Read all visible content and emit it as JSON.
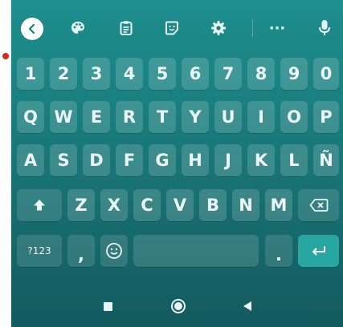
{
  "toolbar": {
    "icons": [
      "back-icon",
      "palette-icon",
      "clipboard-icon",
      "sticker-icon",
      "settings-icon",
      "more-icon",
      "mic-icon"
    ],
    "more_label": "···"
  },
  "rows": {
    "numbers": [
      "1",
      "2",
      "3",
      "4",
      "5",
      "6",
      "7",
      "8",
      "9",
      "0"
    ],
    "row1": [
      "Q",
      "W",
      "E",
      "R",
      "T",
      "Y",
      "U",
      "I",
      "O",
      "P"
    ],
    "row2": [
      "A",
      "S",
      "D",
      "F",
      "G",
      "H",
      "J",
      "K",
      "L",
      "Ñ"
    ],
    "row3": [
      "Z",
      "X",
      "C",
      "V",
      "B",
      "N",
      "M"
    ]
  },
  "bottom": {
    "symbols_label": "?123",
    "comma_label": ",",
    "period_label": "."
  },
  "nav": {
    "icons": [
      "recents-square-icon",
      "home-circle-icon",
      "back-triangle-icon"
    ]
  },
  "colors": {
    "keyboard_top": "#1e8e8e",
    "keyboard_bottom": "#135a5f",
    "enter_key": "#27a6a2",
    "key_text": "#ecf6f6"
  }
}
